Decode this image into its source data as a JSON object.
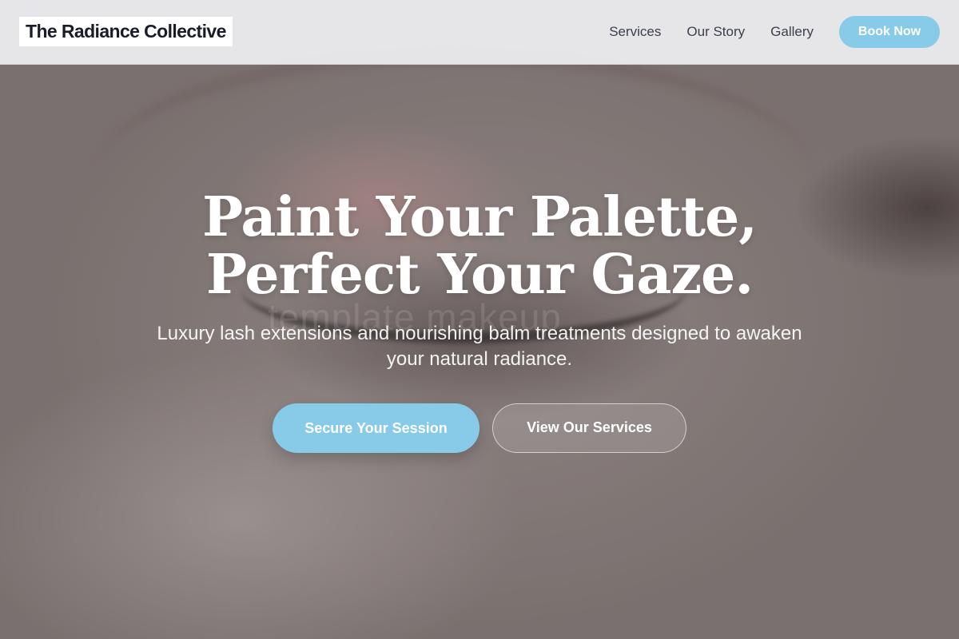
{
  "header": {
    "logo": "The Radiance Collective",
    "nav": [
      {
        "label": "Services"
      },
      {
        "label": "Our Story"
      },
      {
        "label": "Gallery"
      }
    ],
    "cta_label": "Book Now"
  },
  "hero": {
    "headline_line1": "Paint Your Palette,",
    "headline_line2": "Perfect Your Gaze.",
    "subtitle": "Luxury lash extensions and nourishing balm treatments designed to awaken your natural radiance.",
    "primary_cta": "Secure Your Session",
    "secondary_cta": "View Our Services",
    "watermark": "template makeup"
  },
  "colors": {
    "accent": "#87cbe8",
    "header_bg": "#eeeef1",
    "logo_text": "#1a1d29",
    "nav_text": "#3a3f4b"
  }
}
